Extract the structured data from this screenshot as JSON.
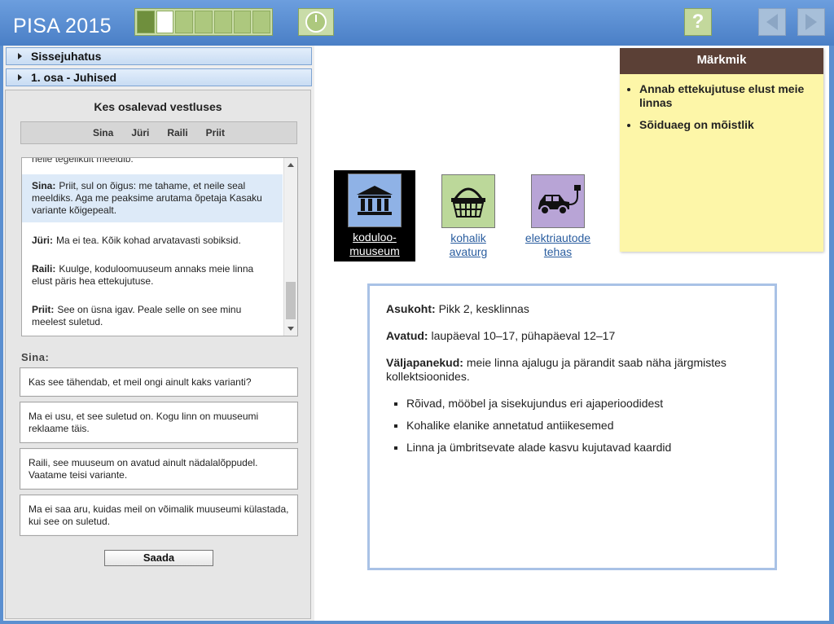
{
  "app": {
    "title": "PISA 2015"
  },
  "progress": {
    "segments": 7,
    "done": 1,
    "current": 2
  },
  "nav": {
    "help_label": "?"
  },
  "sidebar": {
    "sections": [
      "Sissejuhatus",
      "1. osa - Juhised"
    ]
  },
  "chat": {
    "title": "Kes osalevad vestluses",
    "participants": [
      "Sina",
      "Jüri",
      "Raili",
      "Priit"
    ],
    "cut_text": "neile tegelikult meeldib.",
    "messages": [
      {
        "speaker": "Sina:",
        "text": "Priit, sul on õigus: me tahame, et neile seal meeldiks. Aga me peaksime arutama õpetaja Kasaku variante kõigepealt."
      },
      {
        "speaker": "Jüri:",
        "text": "Ma ei tea. Kõik kohad arvatavasti sobiksid."
      },
      {
        "speaker": "Raili:",
        "text": "Kuulge, koduloomuuseum annaks meie linna elust päris hea ettekujutuse."
      },
      {
        "speaker": "Priit:",
        "text": "See on üsna igav. Peale selle on see minu meelest suletud."
      }
    ],
    "reply_label": "Sina:",
    "options": [
      "Kas see tähendab, et meil ongi ainult kaks varianti?",
      "Ma ei usu, et see suletud on. Kogu linn on muuseumi reklaame täis.",
      "Raili, see muuseum on avatud ainult nädalalõppudel. Vaatame teisi variante.",
      "Ma ei saa aru, kuidas meil on võimalik muuseumi külastada, kui see on suletud."
    ],
    "send_label": "Saada"
  },
  "notepad": {
    "title": "Märkmik",
    "items": [
      "Annab ettekujutuse elust meie linnas",
      "Sõiduaeg on mõistlik"
    ]
  },
  "places": [
    {
      "label_line1": "koduloo-",
      "label_line2": "muuseum",
      "icon": "museum-icon",
      "color": "#8fb2e6"
    },
    {
      "label_line1": "kohalik",
      "label_line2": "avaturg",
      "icon": "basket-icon",
      "color": "#bcd89a"
    },
    {
      "label_line1": "elektriautode",
      "label_line2": "tehas",
      "icon": "electric-car-icon",
      "color": "#b8a4d6"
    }
  ],
  "info": {
    "location_label": "Asukoht:",
    "location_value": "Pikk 2, kesklinnas",
    "open_label": "Avatud:",
    "open_value": "laupäeval 10–17, pühapäeval 12–17",
    "exhibits_label": "Väljapanekud:",
    "exhibits_value": "meie linna ajalugu ja pärandit saab näha järgmistes kollektsioonides.",
    "exhibits": [
      "Rõivad, mööbel ja sisekujundus eri ajaperioodidest",
      "Kohalike elanike annetatud antiikesemed",
      "Linna ja ümbritsevate alade kasvu kujutavad kaardid"
    ]
  }
}
